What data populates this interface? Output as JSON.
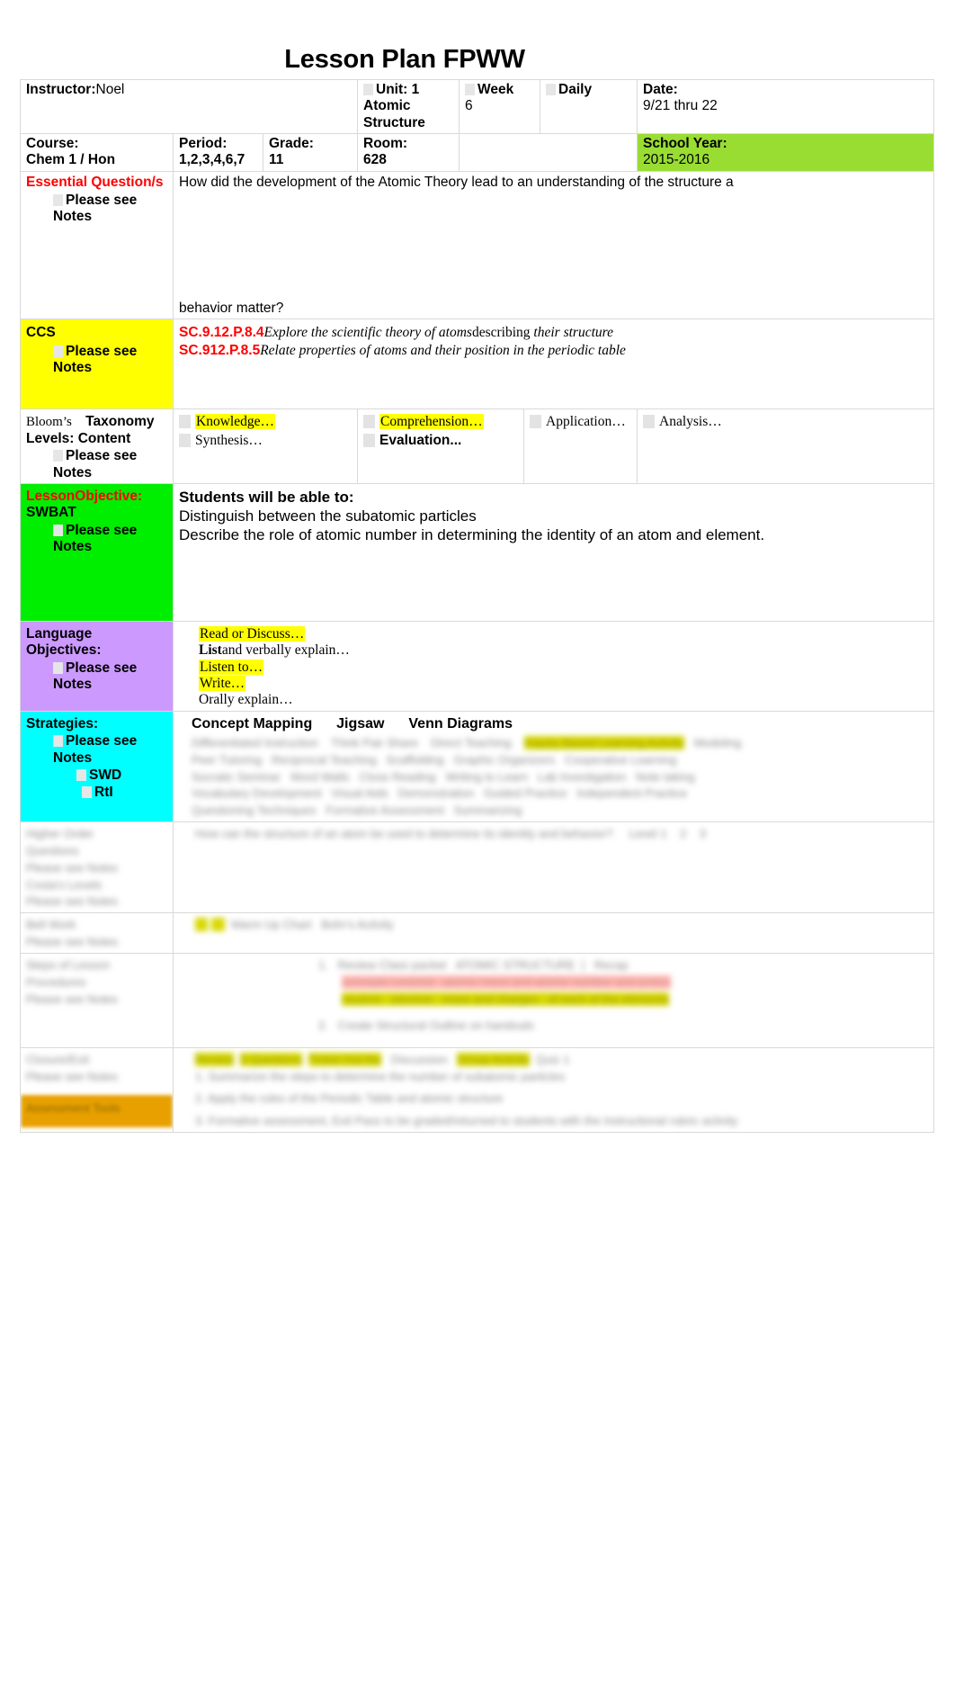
{
  "title": "Lesson Plan FPWW",
  "header": {
    "instructor_label": "Instructor:",
    "instructor_value": "Noel",
    "unit_label": "Unit: 1",
    "unit_value_line2": "Atomic",
    "unit_value_line3": "Structure",
    "week_label": "Week",
    "week_value": "6",
    "daily_label": "Daily",
    "date_label": "Date:",
    "date_value": "9/21 thru 22",
    "course_label": "Course:",
    "course_value": "Chem 1 / Hon",
    "period_label": "Period:",
    "period_value": "1,2,3,4,6,7",
    "grade_label": "Grade:",
    "grade_value": "11",
    "room_label": "Room:",
    "room_value": "628",
    "school_year_label": "School Year:",
    "school_year_value": "2015-2016"
  },
  "essential_question": {
    "label": "Essential Question/s",
    "note": "Please see Notes",
    "text_line1": "How did the development of the Atomic Theory lead to an understanding of the structure a",
    "text_line2": "behavior matter?"
  },
  "ccs": {
    "label": "CCS",
    "note": "Please see Notes",
    "items": [
      {
        "code": "SC.9.12.P.8.4",
        "text_italic": "Explore the scientific theory of atoms",
        "text_plain": "describing ",
        "text_italic2": "their structure"
      },
      {
        "code": "SC.912.P.8.5",
        "text_italic": "Relate properties of atoms and their position in the periodic table",
        "text_plain": "",
        "text_italic2": ""
      }
    ]
  },
  "blooms": {
    "label_line1_a": "Bloom’s",
    "label_line1_b": "Taxonomy",
    "label_line2": "Levels: Content",
    "note": "Please see Notes",
    "levels": [
      {
        "name": "Knowledge…",
        "highlighted": true,
        "bold": false
      },
      {
        "name": "Comprehension…",
        "highlighted": true,
        "bold": false
      },
      {
        "name": "Application…",
        "highlighted": false,
        "bold": false
      },
      {
        "name": "Analysis…",
        "highlighted": false,
        "bold": false
      },
      {
        "name": "Synthesis…",
        "highlighted": false,
        "bold": false
      },
      {
        "name": "Evaluation...",
        "highlighted": false,
        "bold": true
      }
    ]
  },
  "lesson_objective": {
    "label": "LessonObjective:",
    "sublabel": "SWBAT",
    "note": "Please see Notes",
    "heading": "Students will be able to:",
    "items": [
      "Distinguish between the subatomic particles",
      "Describe the role of atomic number in determining the identity of an atom and element."
    ]
  },
  "language_objectives": {
    "label": "Language Objectives:",
    "note": "Please see Notes",
    "items": [
      {
        "text": "Read or Discuss…",
        "highlighted": true,
        "bold_prefix": ""
      },
      {
        "text": "and verbally explain…",
        "highlighted": false,
        "bold_prefix": "List"
      },
      {
        "text": "Listen to…",
        "highlighted": true,
        "bold_prefix": ""
      },
      {
        "text": "Write…",
        "highlighted": true,
        "bold_prefix": ""
      },
      {
        "text": "Orally explain…",
        "highlighted": false,
        "bold_prefix": ""
      }
    ]
  },
  "strategies": {
    "label": "Strategies:",
    "note": "Please see Notes",
    "sub1": "SWD",
    "sub2": "RtI",
    "items": [
      "Concept Mapping",
      "Jigsaw",
      "Venn Diagrams"
    ]
  },
  "colors": {
    "ccs_bg": "#ffff00",
    "objective_bg": "#00ee00",
    "language_bg": "#cc99ff",
    "strategies_bg": "#00ffff",
    "schoolyear_bg": "#99dd33",
    "accent_red": "#ff0000",
    "highlight_yellow": "#ffff00",
    "bottom_gold": "#e8a000"
  }
}
